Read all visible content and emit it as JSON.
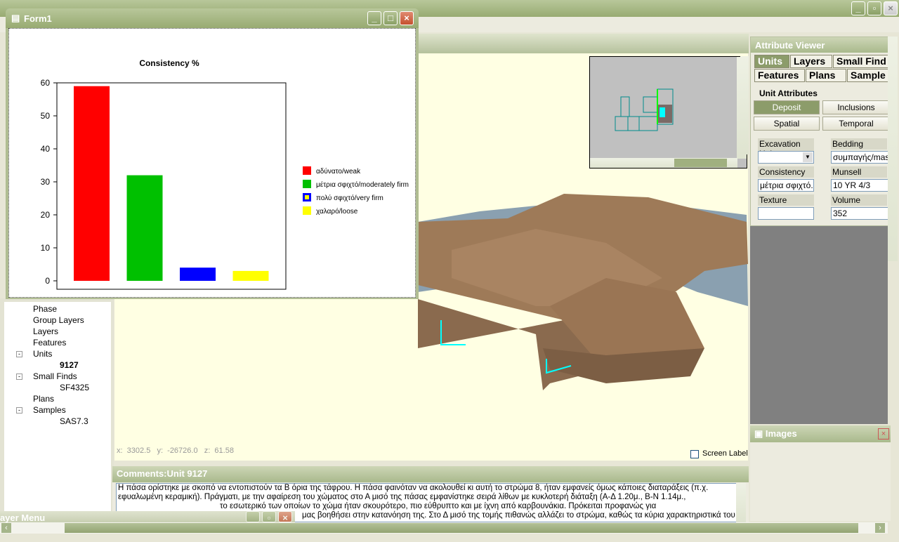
{
  "form1": {
    "title": "Form1"
  },
  "chart_data": {
    "type": "bar",
    "title": "Consistency %",
    "categories": [
      "αδύνατο/weak",
      "μέτρια σφιχτό/moderately firm",
      "πολύ σφιχτό/very firm",
      "χαλαρό/loose"
    ],
    "values": [
      59,
      32,
      4,
      3
    ],
    "colors": [
      "#ff0000",
      "#00c000",
      "#0000ff",
      "#ffff00"
    ],
    "ylim": [
      0,
      60
    ],
    "yticks": [
      "0",
      "10",
      "20",
      "30",
      "40",
      "50",
      "60"
    ],
    "legend_position": "right",
    "grid": false
  },
  "viewer": {
    "coords": "x:  3302.5   y:  -26726.0   z:  61.58",
    "screen_label": "Screen Label",
    "screen_label_checked": false
  },
  "tree": {
    "items": [
      {
        "label": "Phase",
        "level": 0
      },
      {
        "label": "Group Layers",
        "level": 0
      },
      {
        "label": "Layers",
        "level": 0
      },
      {
        "label": "Features",
        "level": 0
      },
      {
        "label": "Units",
        "level": 0,
        "expanded": true
      },
      {
        "label": "9127",
        "level": 1,
        "bold": true
      },
      {
        "label": "Small Finds",
        "level": 0,
        "expanded": true
      },
      {
        "label": "SF4325",
        "level": 1
      },
      {
        "label": "Plans",
        "level": 0
      },
      {
        "label": "Samples",
        "level": 0,
        "expanded": true
      },
      {
        "label": "SAS7.3",
        "level": 1
      }
    ]
  },
  "attr": {
    "title": "Attribute Viewer",
    "tabs": [
      "Units",
      "Layers",
      "Small Find",
      "Features",
      "Plans",
      "Sample"
    ],
    "group": "Unit Attributes",
    "buttons": [
      "Deposit",
      "Inclusions",
      "Spatial",
      "Temporal"
    ],
    "fields": {
      "excavation_unit": {
        "label": "Excavation Unit",
        "value": ""
      },
      "bedding": {
        "label": "Bedding",
        "value": "συμπαγής/mas"
      },
      "consistency": {
        "label": "Consistency",
        "value": "μέτρια σφιχτό."
      },
      "munsell": {
        "label": "Munsell",
        "value": "10 YR 4/3"
      },
      "texture": {
        "label": "Texture",
        "value": ""
      },
      "volume": {
        "label": "Volume",
        "value": "352"
      }
    }
  },
  "images": {
    "title": "Images"
  },
  "comments": {
    "title": "Comments:Unit 9127",
    "lines": [
      "Η πάσα ορίστηκε με σκοπό να εντοπιστούν τα Β όρια της τάφρου. Η πάσα φαινόταν να ακολουθεί κι αυτή το στρώμα 8, ήταν εμφανείς όμως κάποιες διαταράξεις (π.χ.",
      "εφυαλωμένη κεραμική). Πράγματι, με την αφαίρεση του χώματος στο Α μισό της πάσας εμφανίστηκε σειρά λίθων με κυκλοτερή διάταξη (Α-Δ 1.20μ., Β-Ν 1.14μ.,",
      "το εσωτερικό των οποίων το χώμα ήταν σκουρότερο, πιο εύθρυπτο και με ίχνη από καρβουνάκια. Πρόκειται προφανώς για",
      "μας βοηθήσει στην κατανόηση της. Στο Δ μισό της τομής πιθανώς αλλάζει το στρώμα, καθώς τα κύρια χαρακτηριστικά του"
    ]
  },
  "layer_menu": {
    "title": "Layer Menu"
  }
}
